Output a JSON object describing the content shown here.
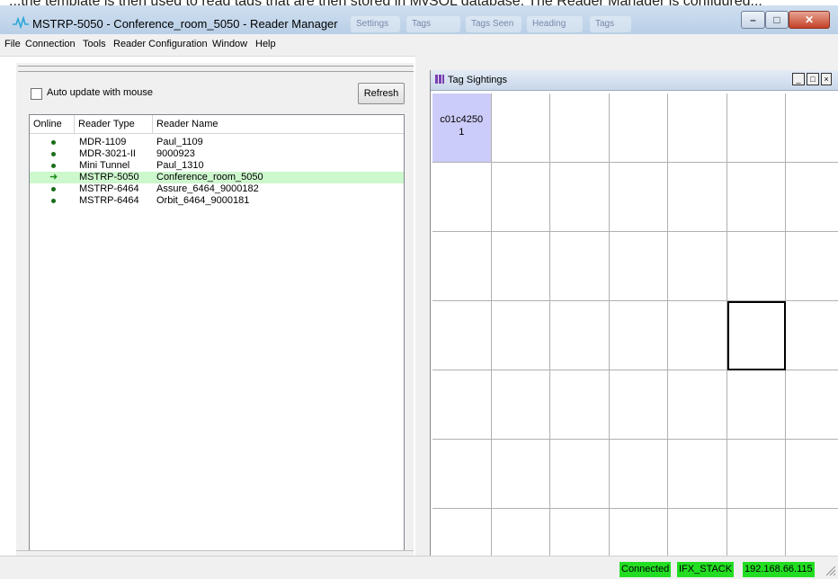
{
  "top_strip_text": "...the template is then used to read tags that are then stored in MySQL database. The Reader Manager is configured...",
  "window": {
    "title": "MSTRP-5050 - Conference_room_5050 - Reader Manager",
    "taskbar_ghosts": [
      "Settings",
      "Tags",
      "Tags Seen",
      "Heading",
      "Tags"
    ]
  },
  "menu": [
    "File",
    "Connection",
    "Tools",
    "Reader Configuration",
    "Window",
    "Help"
  ],
  "left_panel": {
    "auto_update_label": "Auto update with mouse",
    "auto_update_checked": false,
    "refresh_label": "Refresh",
    "columns": [
      "Online",
      "Reader Type",
      "Reader Name"
    ],
    "readers": [
      {
        "status": "online",
        "type": "MDR-1109",
        "name": "Paul_1109",
        "selected": false
      },
      {
        "status": "online",
        "type": "MDR-3021-II",
        "name": "9000923",
        "selected": false
      },
      {
        "status": "online",
        "type": "Mini Tunnel",
        "name": "Paul_1310",
        "selected": false
      },
      {
        "status": "current",
        "type": "MSTRP-5050",
        "name": "Conference_room_5050",
        "selected": true
      },
      {
        "status": "online",
        "type": "MSTRP-6464",
        "name": "Assure_6464_9000182",
        "selected": false
      },
      {
        "status": "online",
        "type": "MSTRP-6464",
        "name": "Orbit_6464_9000181",
        "selected": false
      }
    ]
  },
  "tag_sightings": {
    "title": "Tag Sightings",
    "buttons": [
      "_",
      "□",
      "×"
    ],
    "tag_label_line1": "c01c4250",
    "tag_label_line2": "1"
  },
  "status": {
    "connection": "Connected",
    "stack": "IFX_STACK",
    "ip": "192.168.66.115"
  },
  "colors": {
    "selected_row": "#cdf7cd",
    "tag_cell": "#ccccfa",
    "status_green": "#22dd22",
    "online_dot": "#1a6d1a"
  }
}
